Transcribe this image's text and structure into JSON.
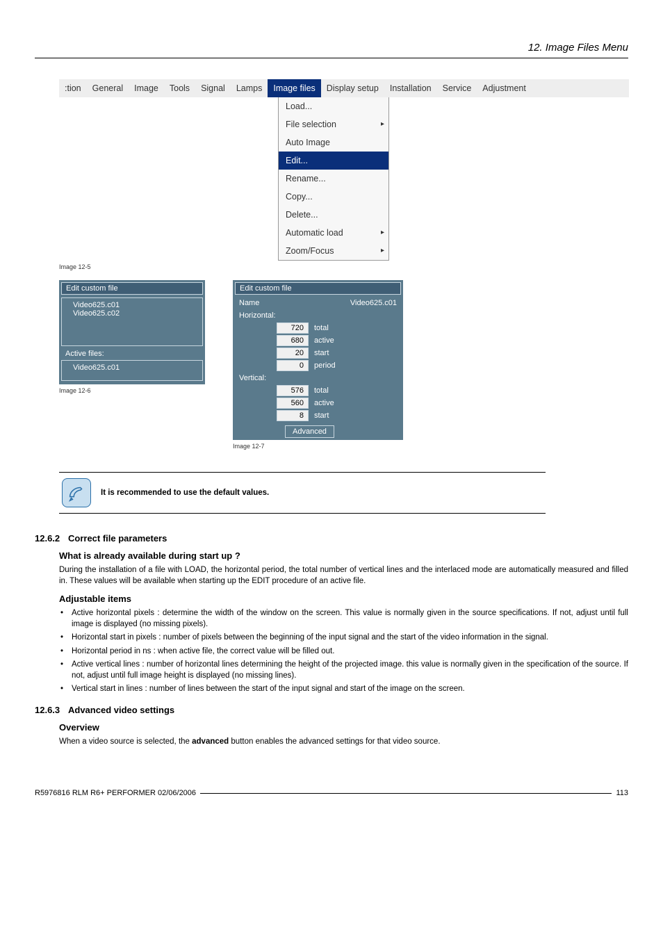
{
  "header": {
    "title": "12.  Image Files Menu"
  },
  "menubar": {
    "items": [
      {
        "label": ":tion"
      },
      {
        "label": "General"
      },
      {
        "label": "Image"
      },
      {
        "label": "Tools"
      },
      {
        "label": "Signal"
      },
      {
        "label": "Lamps"
      },
      {
        "label": "Image files",
        "active": true
      },
      {
        "label": "Display setup"
      },
      {
        "label": "Installation"
      },
      {
        "label": "Service"
      },
      {
        "label": "Adjustment"
      }
    ]
  },
  "dropdown": {
    "items": [
      {
        "label": "Load..."
      },
      {
        "label": "File selection",
        "arrow": true
      },
      {
        "label": "Auto Image"
      },
      {
        "label": "Edit...",
        "highlight": true
      },
      {
        "label": "Rename..."
      },
      {
        "label": "Copy..."
      },
      {
        "label": "Delete..."
      },
      {
        "label": "Automatic load",
        "arrow": true
      },
      {
        "label": "Zoom/Focus",
        "arrow": true
      }
    ]
  },
  "captions": {
    "c1": "Image 12-5",
    "c2": "Image 12-6",
    "c3": "Image 12-7"
  },
  "panel1": {
    "title": "Edit custom file",
    "file1": "Video625.c01",
    "file2": "Video625.c02",
    "active_label": "Active files:",
    "active_file": "Video625.c01"
  },
  "panel2": {
    "title": "Edit custom file",
    "name_label": "Name",
    "name_value": "Video625.c01",
    "horizontal_label": "Horizontal:",
    "h_total": {
      "val": "720",
      "label": "total"
    },
    "h_active": {
      "val": "680",
      "label": "active"
    },
    "h_start": {
      "val": "20",
      "label": "start"
    },
    "h_period": {
      "val": "0",
      "label": "period"
    },
    "vertical_label": "Vertical:",
    "v_total": {
      "val": "576",
      "label": "total"
    },
    "v_active": {
      "val": "560",
      "label": "active"
    },
    "v_start": {
      "val": "8",
      "label": "start"
    },
    "advanced": "Advanced"
  },
  "note": {
    "text": "It is recommended to use the default values."
  },
  "s1": {
    "num": "12.6.2",
    "title": "Correct file parameters",
    "sub1": "What is already available during start up ?",
    "p1": "During the installation of a file with LOAD, the horizontal period, the total number of vertical lines and the interlaced mode are automatically measured and filled in. These values will be available when starting up the EDIT procedure of an active file.",
    "sub2": "Adjustable items",
    "li1": "Active horizontal pixels : determine the width of the window on the screen. This value is normally given in the source specifications. If not, adjust until full image is displayed (no missing pixels).",
    "li2": "Horizontal start in pixels : number of pixels between the beginning of the input signal and the start of the video information in the signal.",
    "li3": "Horizontal period in ns : when active file, the correct value will be filled out.",
    "li4": "Active vertical lines : number of horizontal lines determining the height of the projected image. this value is normally given in the specification of the source. If not, adjust until full image height is displayed (no missing lines).",
    "li5": "Vertical start in lines : number of lines between the start of the input signal and start of the image on the screen."
  },
  "s2": {
    "num": "12.6.3",
    "title": "Advanced video settings",
    "sub1": "Overview",
    "p1a": "When a video source is selected, the ",
    "p1b": "advanced",
    "p1c": " button enables the advanced settings for that video source."
  },
  "footer": {
    "left": "R5976816  RLM R6+ PERFORMER  02/06/2006",
    "right": "113"
  }
}
